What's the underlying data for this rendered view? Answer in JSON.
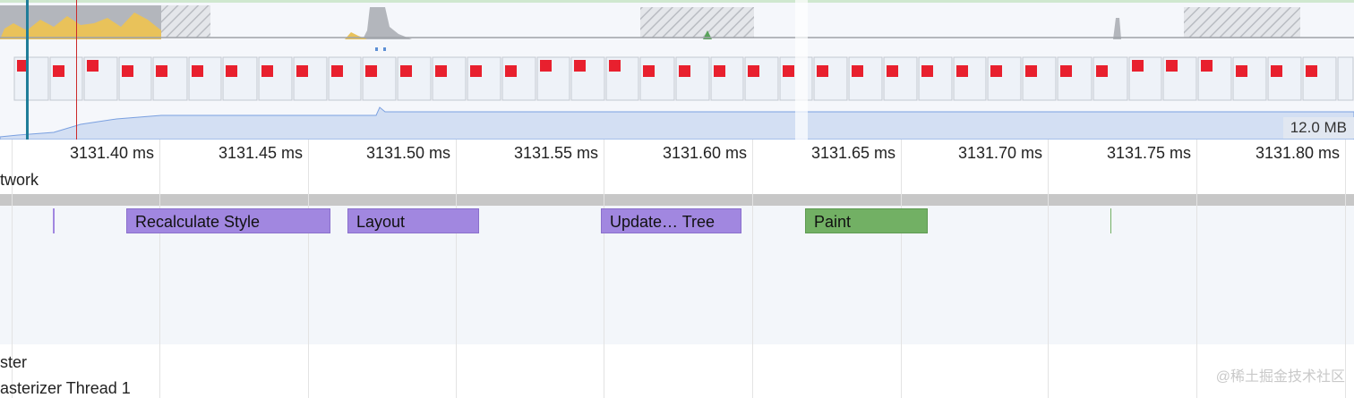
{
  "overview": {
    "memory_label": "12.0 MB"
  },
  "ruler": {
    "ticks": [
      "3131.40 ms",
      "3131.45 ms",
      "3131.50 ms",
      "3131.55 ms",
      "3131.60 ms",
      "3131.65 ms",
      "3131.70 ms",
      "3131.75 ms",
      "3131.80 ms"
    ]
  },
  "tracks": {
    "network": "twork",
    "raster": "ster",
    "rasterizer_thread": "asterizer Thread 1"
  },
  "events": {
    "recalculate_style": "Recalculate Style",
    "layout": "Layout",
    "update_layer_tree": "Update… Tree",
    "paint": "Paint"
  },
  "colors": {
    "rendering": "#a187e0",
    "painting": "#72b064",
    "frame": "#e8202e",
    "memory": "#7aa0e0",
    "scripting": "#e9c25a"
  },
  "watermark": "@稀土掘金技术社区"
}
